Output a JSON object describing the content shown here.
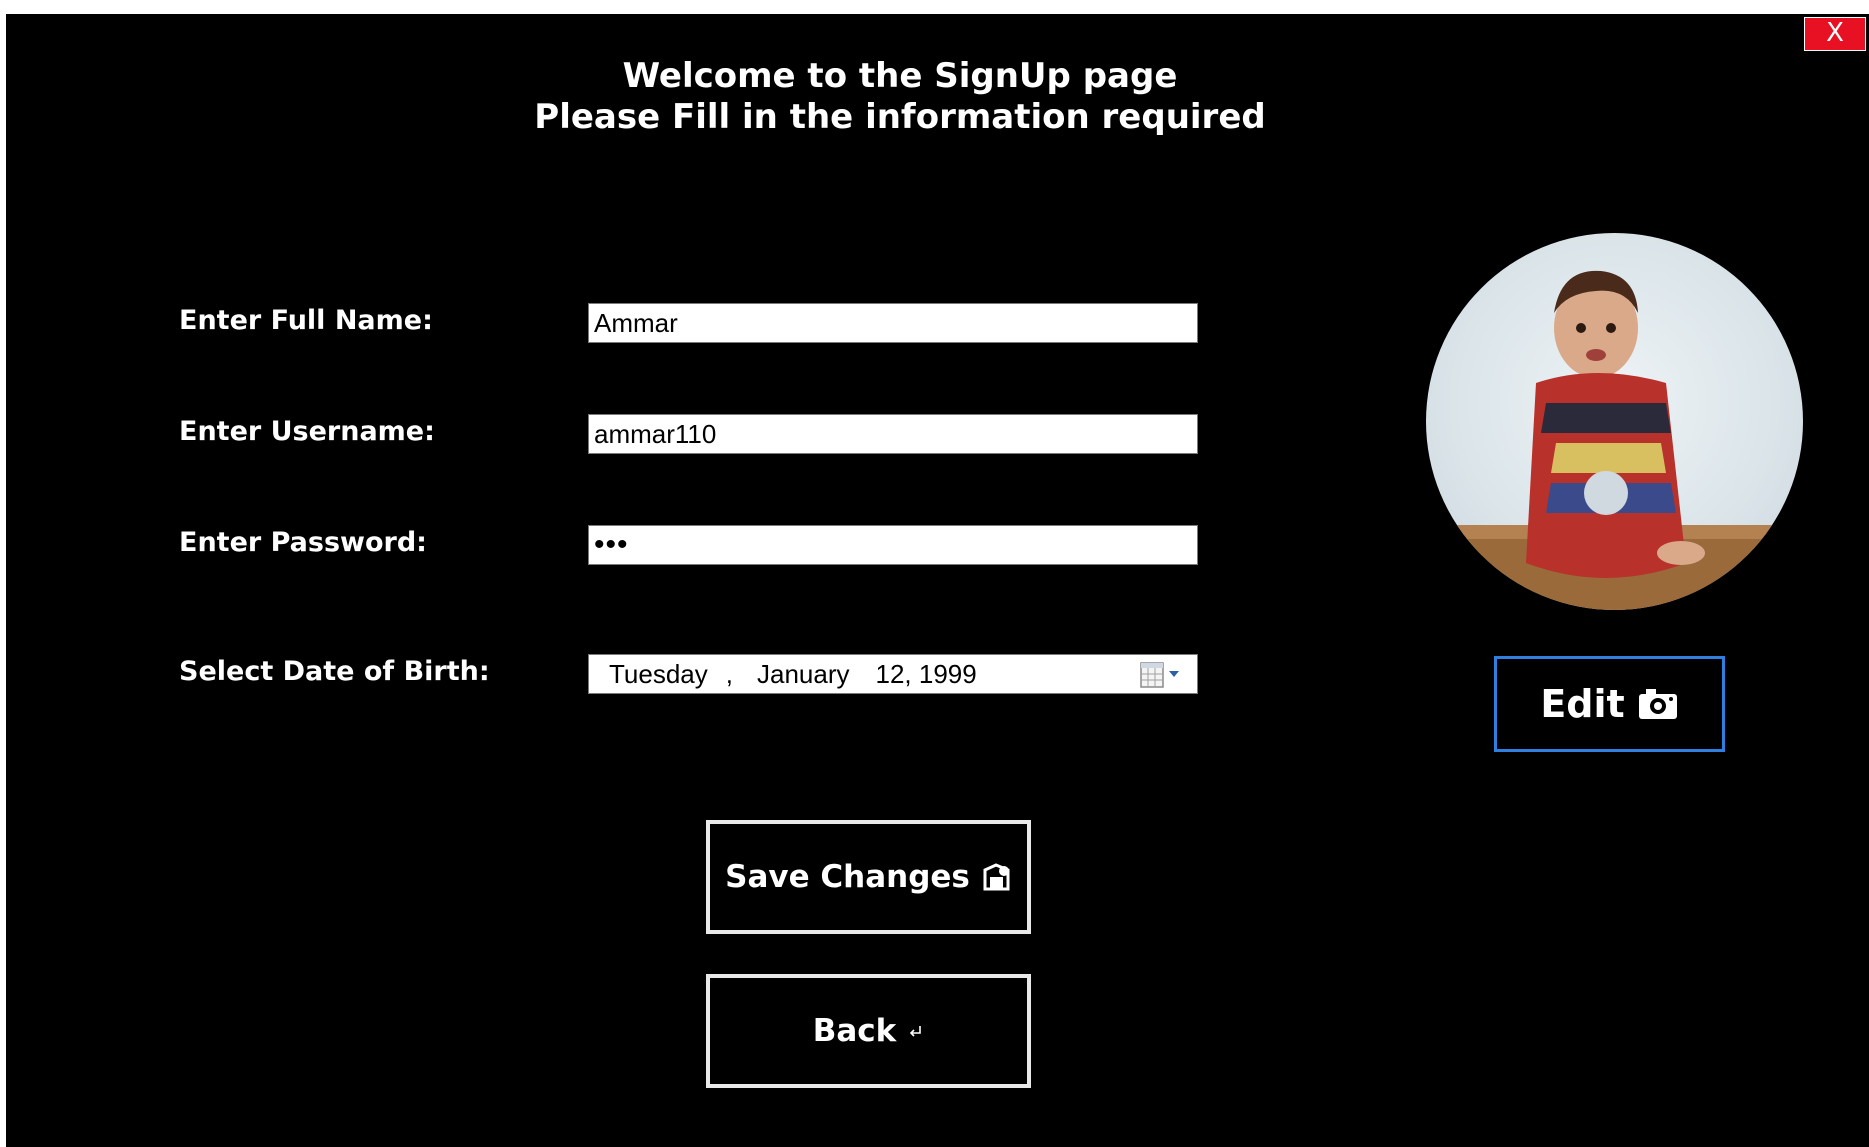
{
  "window": {
    "close_label": "X"
  },
  "header": {
    "line1": "Welcome to the SignUp page",
    "line2": "Please Fill in the information required"
  },
  "form": {
    "full_name": {
      "label": "Enter Full Name:",
      "value": "Ammar"
    },
    "username": {
      "label": "Enter Username:",
      "value": "ammar110"
    },
    "password": {
      "label": "Enter Password:",
      "value": "•••"
    },
    "dob": {
      "label": "Select Date of Birth:",
      "weekday": "Tuesday",
      "sep": ",",
      "month": "January",
      "day_year": "12, 1999",
      "icon": "calendar-icon"
    }
  },
  "profile": {
    "photo": "profile-photo",
    "edit_label": "Edit",
    "edit_icon": "camera-icon"
  },
  "actions": {
    "save_label": "Save Changes",
    "save_icon": "save-icon",
    "back_label": "Back",
    "back_icon": "return-arrow-icon"
  },
  "colors": {
    "background": "#000000",
    "close": "#e81123",
    "edit_border": "#2f7fe0",
    "text": "#ffffff"
  }
}
